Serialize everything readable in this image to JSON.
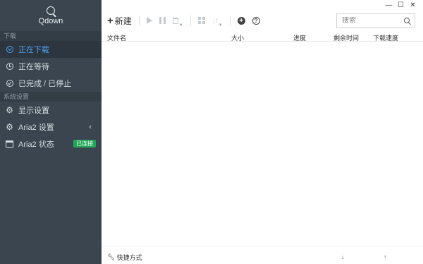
{
  "app": {
    "name": "Qdown"
  },
  "window": {
    "controls": [
      "—",
      "☐",
      "✕"
    ]
  },
  "sidebar": {
    "sections": [
      {
        "title": "下载",
        "items": [
          {
            "label": "正在下载",
            "icon": "download-circle-icon",
            "active": true
          },
          {
            "label": "正在等待",
            "icon": "clock-icon",
            "active": false
          },
          {
            "label": "已完成 / 已停止",
            "icon": "check-circle-icon",
            "active": false
          }
        ]
      },
      {
        "title": "系统设置",
        "items": [
          {
            "label": "显示设置",
            "icon": "gear-icon"
          },
          {
            "label": "Aria2 设置",
            "icon": "gears-icon",
            "chevron": "‹"
          },
          {
            "label": "Aria2 状态",
            "icon": "server-status-icon",
            "badge": "已连接"
          }
        ]
      }
    ]
  },
  "toolbar": {
    "new_label": "新建",
    "buttons": [
      "play-icon",
      "pause-icon",
      "delete-icon",
      "view-grid-icon",
      "sort-icon",
      "add-circle-icon",
      "help-circle-icon"
    ]
  },
  "search": {
    "placeholder": "搜索",
    "value": ""
  },
  "table": {
    "columns": [
      "文件名",
      "大小",
      "进度",
      "剩余时间",
      "下载速度"
    ],
    "rows": []
  },
  "statusbar": {
    "shortcut_label": "快捷方式",
    "download_speed": "",
    "upload_speed": ""
  },
  "colors": {
    "sidebar_bg": "#3a454f",
    "sidebar_active": "#2d363e",
    "accent": "#4aa3f2",
    "badge_green": "#21a557"
  }
}
